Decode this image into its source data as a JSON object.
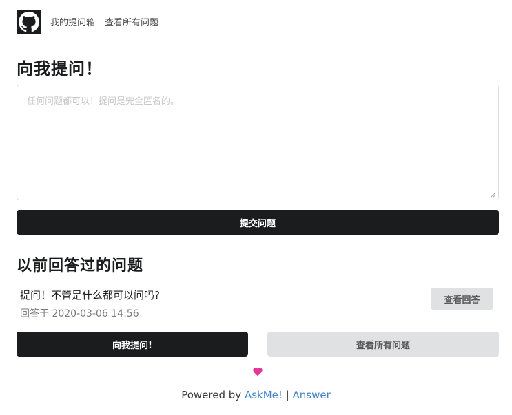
{
  "nav": {
    "logo_icon": "github-icon",
    "inbox_link": "我的提问箱",
    "all_questions_link": "查看所有问题"
  },
  "ask": {
    "title": "向我提问！",
    "placeholder": "任何问题都可以！提问是完全匿名的。",
    "value": "",
    "submit_label": "提交问题"
  },
  "answered": {
    "title": "以前回答过的问题",
    "items": [
      {
        "question": "提问！不管是什么都可以问吗?",
        "answered_at": "回答于 2020-03-06 14:56",
        "view_label": "查看回答"
      }
    ]
  },
  "actions": {
    "ask_me_label": "向我提问!",
    "view_all_label": "查看所有问题"
  },
  "footer": {
    "powered_by": "Powered by",
    "askme_link": "AskMe!",
    "separator": "|",
    "answer_link": "Answer",
    "heart_icon": "heart-icon",
    "heart_color": "#e03997"
  },
  "colors": {
    "dark": "#1b1c1d",
    "grey_button": "#e0e1e2",
    "link": "#4183c4"
  }
}
